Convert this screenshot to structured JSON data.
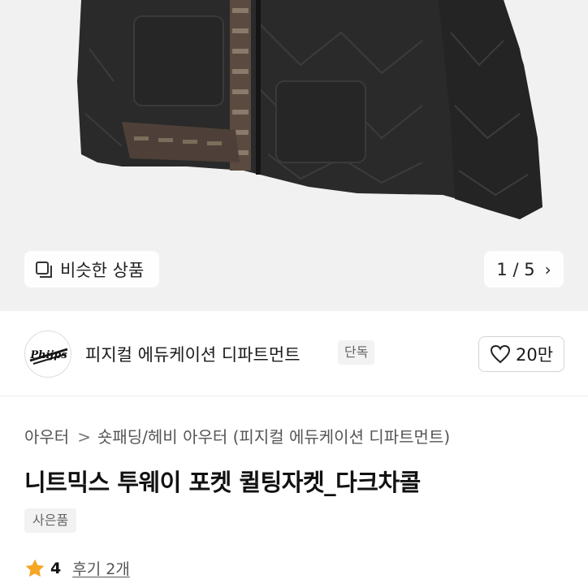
{
  "colors": {
    "background": "#ffffff",
    "hero_bg": "#f1f1f1",
    "star": "#f5a623",
    "jacket": "#2b2b2b"
  },
  "hero": {
    "image": "quilted-jacket-photo",
    "similar_label": "비슷한 상품",
    "similar_icon": "similar-items-icon",
    "counter_text": "1 / 5",
    "next_icon": "chevron-right-icon"
  },
  "brand": {
    "logo_text": "Phijps",
    "name": "피지컬 에듀케이션 디파트먼트",
    "badge": "단독",
    "like_icon": "heart-icon",
    "like_count": "20만"
  },
  "breadcrumb": {
    "level1": "아우터",
    "separator": ">",
    "level2": "숏패딩/헤비 아우터 (피지컬 에듀케이션 디파트먼트)"
  },
  "product": {
    "title": "니트믹스 투웨이 포켓 퀼팅자켓_다크차콜",
    "gift_badge": "사은품"
  },
  "rating": {
    "star_icon": "star-icon",
    "score": "4",
    "reviews_text": "후기 2개"
  }
}
